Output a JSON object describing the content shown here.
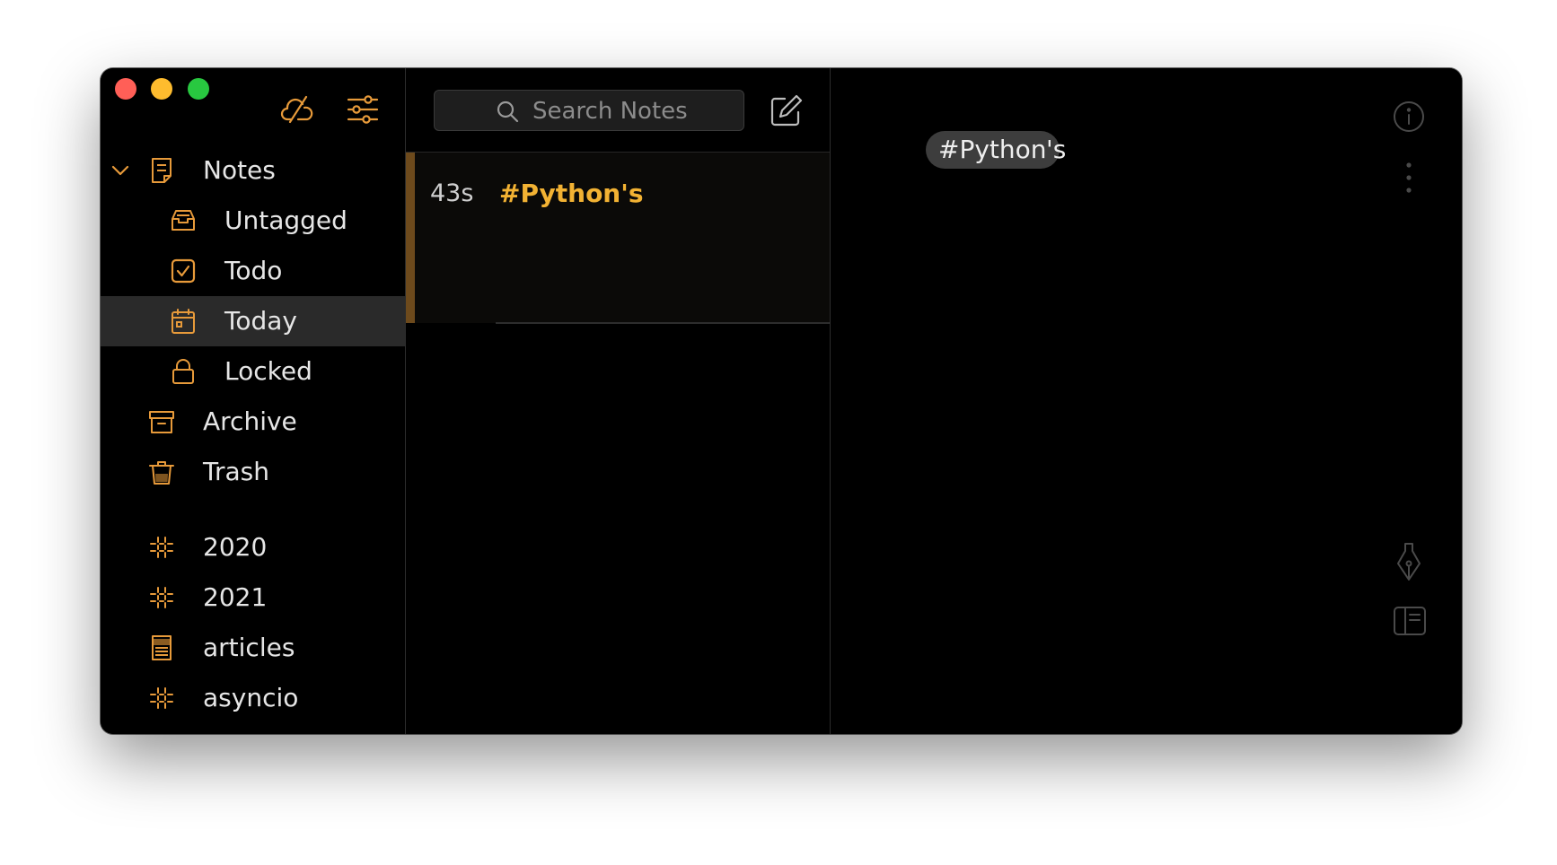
{
  "window": {
    "traffic_lights": {
      "close": "#ff5f57",
      "minimize": "#febc2e",
      "maximize": "#28c840"
    }
  },
  "toolbar": {
    "icons": [
      "sync-off-icon",
      "filter-sliders-icon"
    ]
  },
  "sidebar": {
    "accent_color": "#e79a3a",
    "notes_label": "Notes",
    "items": [
      {
        "label": "Untagged",
        "icon": "inbox-tray-icon"
      },
      {
        "label": "Todo",
        "icon": "checkbox-icon"
      },
      {
        "label": "Today",
        "icon": "calendar-icon",
        "selected": true
      },
      {
        "label": "Locked",
        "icon": "lock-icon"
      },
      {
        "label": "Archive",
        "icon": "archive-box-icon"
      },
      {
        "label": "Trash",
        "icon": "trash-icon"
      }
    ],
    "tags": [
      {
        "label": "2020",
        "icon": "hashtag-icon"
      },
      {
        "label": "2021",
        "icon": "hashtag-icon"
      },
      {
        "label": "articles",
        "icon": "article-stack-icon"
      },
      {
        "label": "asyncio",
        "icon": "hashtag-icon"
      }
    ]
  },
  "notelist": {
    "search_placeholder": "Search Notes",
    "notes": [
      {
        "age": "43s",
        "title": "#Python's"
      }
    ]
  },
  "editor": {
    "tag": "#Python",
    "tag_suffix": "'s",
    "icons": [
      "info-icon",
      "more-dots-icon",
      "pen-nib-icon",
      "sidebar-toggle-icon"
    ]
  }
}
